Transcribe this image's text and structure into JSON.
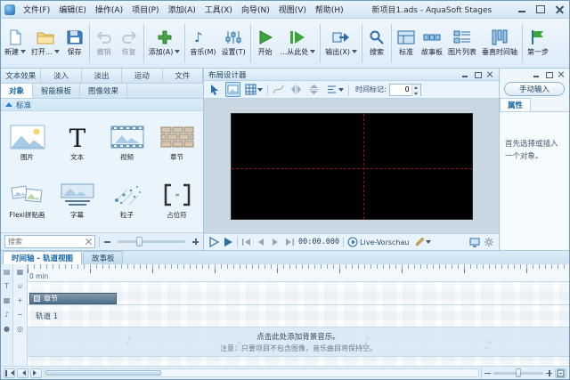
{
  "titlebar": {
    "title": "新项目1.ads - AquaSoft Stages",
    "menus": [
      "文件(F)",
      "编辑(E)",
      "操作(A)",
      "项目(P)",
      "添加(A)",
      "工具(X)",
      "向导(N)",
      "视图(V)",
      "帮助(H)"
    ]
  },
  "toolbar": {
    "labels": [
      "新建",
      "打开...",
      "保存",
      "撤销",
      "恢复",
      "添加(A)",
      "音乐(M)",
      "设置(T)",
      "开始",
      "...从此处",
      "输出(X)",
      "搜索",
      "标准",
      "故事板",
      "图片列表",
      "垂直时间轴",
      "第一步"
    ]
  },
  "left_panel": {
    "tabs": [
      "文本效果",
      "淡入",
      "淡出",
      "运动",
      "文件"
    ],
    "sub_tabs": [
      "对象",
      "智能模板",
      "图像效果"
    ],
    "active_sub_tab": "对象",
    "section": "标准",
    "objects": [
      "图片",
      "文本",
      "视频",
      "章节",
      "Flexi拼贴画",
      "字幕",
      "粒子",
      "占位符"
    ],
    "search": {
      "placeholder": "搜索"
    }
  },
  "layout_designer": {
    "title": "布局设计器",
    "time_marker": {
      "label": "时间标记:",
      "value": "0"
    },
    "transport": {
      "time": "00:00.000",
      "live_preview": "Live-Vorschau"
    }
  },
  "right_panel": {
    "manual_input": "手动输入",
    "properties_tab": "属性",
    "hint": "首先选择或插入一个对象。"
  },
  "timeline": {
    "tabs": [
      "时间轴 - 轨道视图",
      "故事板"
    ],
    "active_tab": "时间轴 - 轨道视图",
    "ruler_label": "0 min",
    "chapter": "章节",
    "track": "轨道 1",
    "music_hint": "点击此处添加背景音乐。",
    "music_note": "注意：只要项目不包含图像，音乐曲目将保持空。"
  }
}
